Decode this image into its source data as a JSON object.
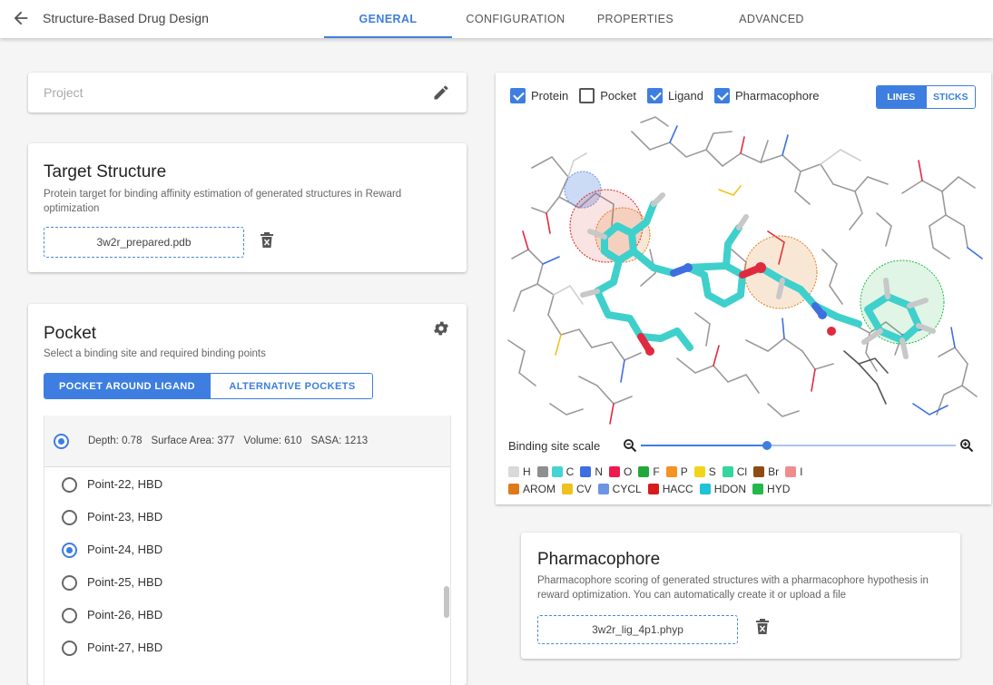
{
  "header": {
    "title": "Structure-Based Drug Design",
    "tabs": [
      {
        "label": "GENERAL",
        "active": true
      },
      {
        "label": "CONFIGURATION",
        "active": false
      },
      {
        "label": "PROPERTIES",
        "active": false
      },
      {
        "label": "ADVANCED",
        "active": false
      }
    ]
  },
  "project": {
    "placeholder": "Project",
    "value": ""
  },
  "target": {
    "title": "Target Structure",
    "description": "Protein target for binding affinity estimation of generated structures in Reward optimization",
    "file": "3w2r_prepared.pdb"
  },
  "pocket": {
    "title": "Pocket",
    "description": "Select a binding site and required binding points",
    "modes": [
      {
        "label": "POCKET AROUND LIGAND",
        "selected": true
      },
      {
        "label": "ALTERNATIVE POCKETS",
        "selected": false
      }
    ],
    "selected_pocket": {
      "depth": "Depth: 0.78",
      "surface_area": "Surface Area: 377",
      "volume": "Volume: 610",
      "sasa": "SASA: 1213"
    },
    "points": [
      {
        "label": "Point-22, HBD",
        "checked": false
      },
      {
        "label": "Point-23, HBD",
        "checked": false
      },
      {
        "label": "Point-24, HBD",
        "checked": true
      },
      {
        "label": "Point-25, HBD",
        "checked": false
      },
      {
        "label": "Point-26, HBD",
        "checked": false
      },
      {
        "label": "Point-27, HBD",
        "checked": false
      }
    ]
  },
  "viewer": {
    "toggles": [
      {
        "label": "Protein",
        "checked": true
      },
      {
        "label": "Pocket",
        "checked": false
      },
      {
        "label": "Ligand",
        "checked": true
      },
      {
        "label": "Pharmacophore",
        "checked": true
      }
    ],
    "render_modes": [
      {
        "label": "LINES",
        "selected": true
      },
      {
        "label": "STICKS",
        "selected": false
      }
    ],
    "scale_label": "Binding site scale",
    "scale_value": 0.4,
    "elements": [
      {
        "label": "H",
        "colors": [
          "#d9d9d9"
        ]
      },
      {
        "label": "C",
        "colors": [
          "#8f8f8f",
          "#45d3d3"
        ]
      },
      {
        "label": "N",
        "colors": [
          "#3d6fe0"
        ]
      },
      {
        "label": "O",
        "colors": [
          "#f0184f"
        ]
      },
      {
        "label": "F",
        "colors": [
          "#22a83a"
        ]
      },
      {
        "label": "P",
        "colors": [
          "#f59324"
        ]
      },
      {
        "label": "S",
        "colors": [
          "#f2d518"
        ]
      },
      {
        "label": "Cl",
        "colors": [
          "#33d69c"
        ]
      },
      {
        "label": "Br",
        "colors": [
          "#8f4b15"
        ]
      },
      {
        "label": "I",
        "colors": [
          "#f08c8c"
        ]
      }
    ],
    "features": [
      {
        "label": "AROM",
        "colors": [
          "#e0791a"
        ]
      },
      {
        "label": "CV",
        "colors": [
          "#eec21e"
        ]
      },
      {
        "label": "CYCL",
        "colors": [
          "#6b95e2"
        ]
      },
      {
        "label": "HACC",
        "colors": [
          "#d61b1b"
        ]
      },
      {
        "label": "HDON",
        "colors": [
          "#1ec3d8"
        ]
      },
      {
        "label": "HYD",
        "colors": [
          "#22b84a"
        ]
      }
    ]
  },
  "pharmacophore": {
    "title": "Pharmacophore",
    "description": "Pharmacophore scoring of generated structures with a pharmacophore hypothesis in reward optimization. You can automatically create it or upload a file",
    "file": "3w2r_lig_4p1.phyp"
  }
}
